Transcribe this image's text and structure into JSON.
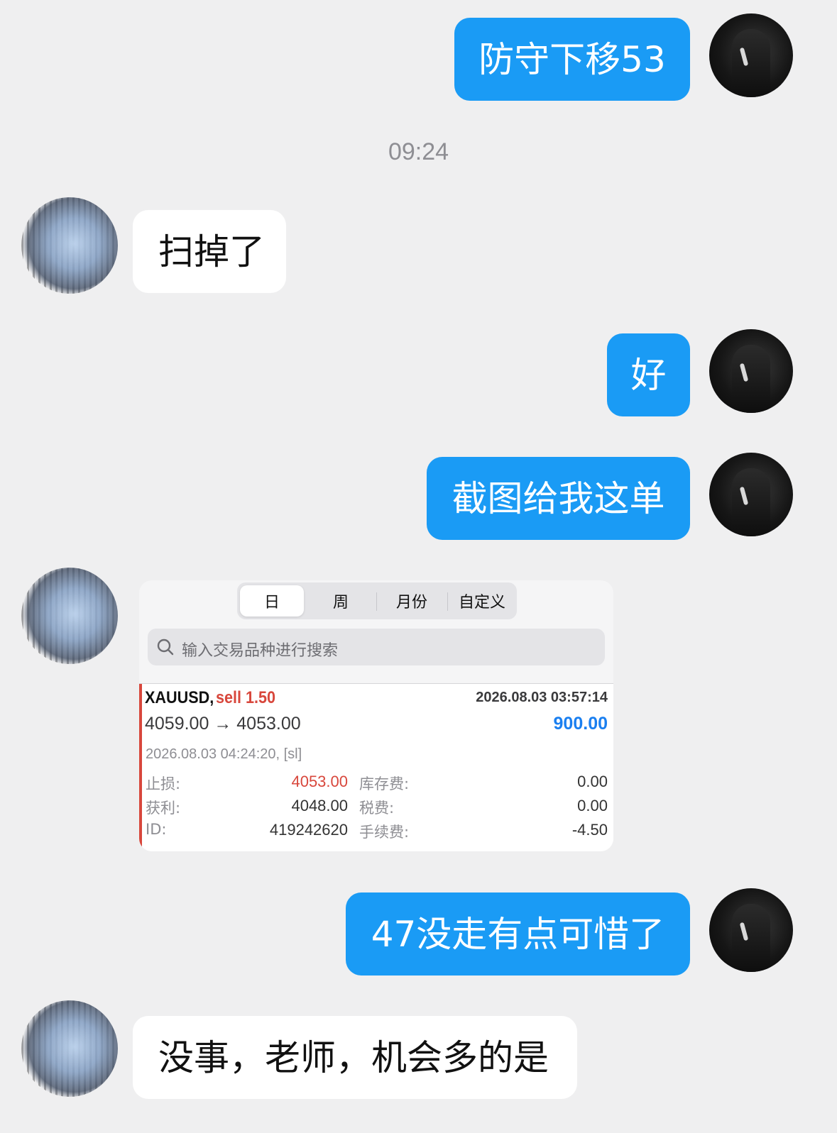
{
  "messages": {
    "m1": "防守下移53",
    "time": "09:24",
    "m2": "扫掉了",
    "m3": "好",
    "m4": "截图给我这单",
    "m5": "47没走有点可惜了",
    "m6": "没事，老师，机会多的是"
  },
  "card": {
    "tabs": [
      "日",
      "周",
      "月份",
      "自定义"
    ],
    "active_tab": "日",
    "search_placeholder": "输入交易品种进行搜索",
    "trade": {
      "symbol": "XAUUSD,",
      "direction": "sell 1.50",
      "open_time": "2026.08.03 03:57:14",
      "prices": "4059.00 → 4053.00",
      "profit": "900.00",
      "close_info": "2026.08.03 04:24:20, [sl]",
      "rows": [
        {
          "l1": "止损:",
          "v1": "4053.00",
          "l2": "库存费:",
          "v2": "0.00"
        },
        {
          "l1": "获利:",
          "v1": "4048.00",
          "l2": "税费:",
          "v2": "0.00"
        },
        {
          "l1": "ID:",
          "v1": "419242620",
          "l2": "手续费:",
          "v2": "-4.50"
        }
      ]
    }
  },
  "colors": {
    "bubble_blue": "#1a9bf5",
    "sell_red": "#d8473c",
    "profit_blue": "#1a7ff0"
  }
}
